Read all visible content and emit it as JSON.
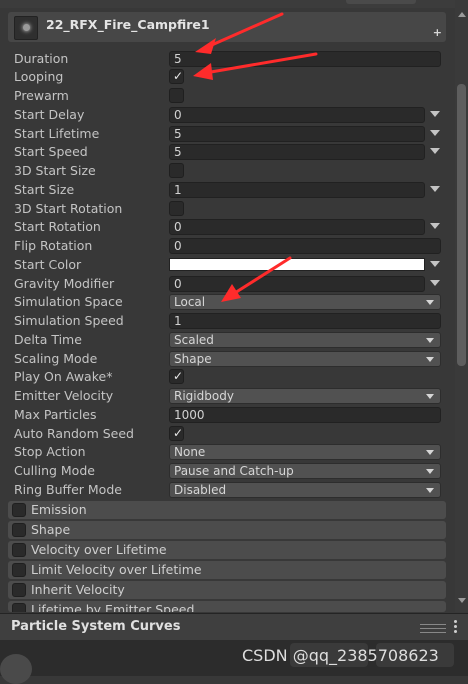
{
  "header": {
    "title": "22_RFX_Fire_Campfire1",
    "plus_glyph": "+"
  },
  "props": {
    "duration": {
      "label": "Duration",
      "value": "5"
    },
    "looping": {
      "label": "Looping",
      "checked": true
    },
    "prewarm": {
      "label": "Prewarm",
      "checked": false
    },
    "start_delay": {
      "label": "Start Delay",
      "value": "0"
    },
    "start_lifetime": {
      "label": "Start Lifetime",
      "value": "5"
    },
    "start_speed": {
      "label": "Start Speed",
      "value": "5"
    },
    "start_size_3d": {
      "label": "3D Start Size",
      "checked": false
    },
    "start_size": {
      "label": "Start Size",
      "value": "1"
    },
    "start_rotation_3d": {
      "label": "3D Start Rotation",
      "checked": false
    },
    "start_rotation": {
      "label": "Start Rotation",
      "value": "0"
    },
    "flip_rotation": {
      "label": "Flip Rotation",
      "value": "0"
    },
    "start_color": {
      "label": "Start Color",
      "color": "#ffffff"
    },
    "gravity_modifier": {
      "label": "Gravity Modifier",
      "value": "0"
    },
    "simulation_space": {
      "label": "Simulation Space",
      "value": "Local"
    },
    "simulation_speed": {
      "label": "Simulation Speed",
      "value": "1"
    },
    "delta_time": {
      "label": "Delta Time",
      "value": "Scaled"
    },
    "scaling_mode": {
      "label": "Scaling Mode",
      "value": "Shape"
    },
    "play_on_awake": {
      "label": "Play On Awake*",
      "checked": true
    },
    "emitter_velocity": {
      "label": "Emitter Velocity",
      "value": "Rigidbody"
    },
    "max_particles": {
      "label": "Max Particles",
      "value": "1000"
    },
    "auto_random_seed": {
      "label": "Auto Random Seed",
      "checked": true
    },
    "stop_action": {
      "label": "Stop Action",
      "value": "None"
    },
    "culling_mode": {
      "label": "Culling Mode",
      "value": "Pause and Catch-up"
    },
    "ring_buffer_mode": {
      "label": "Ring Buffer Mode",
      "value": "Disabled"
    }
  },
  "check_glyph": "✓",
  "modules": [
    {
      "label": "Emission"
    },
    {
      "label": "Shape"
    },
    {
      "label": "Velocity over Lifetime"
    },
    {
      "label": "Limit Velocity over Lifetime"
    },
    {
      "label": "Inherit Velocity"
    },
    {
      "label": "Lifetime by Emitter Speed"
    }
  ],
  "curves_panel": {
    "title": "Particle System Curves"
  },
  "watermark": "CSDN @qq_2385708623",
  "annotation_color": "#ff2b2b"
}
